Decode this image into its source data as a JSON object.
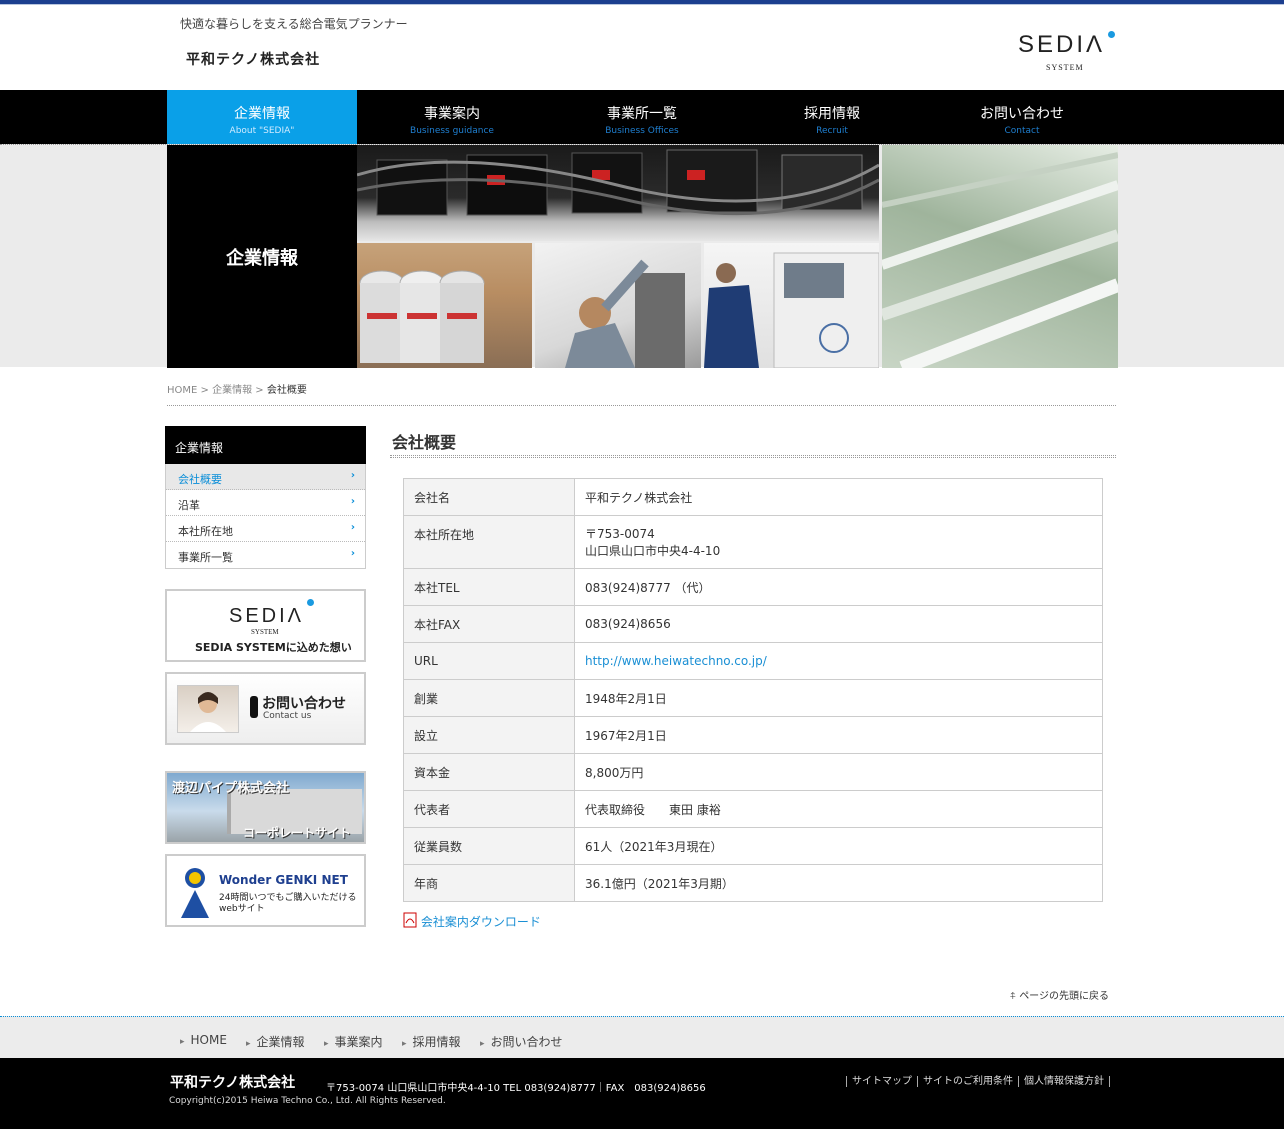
{
  "header": {
    "tagline": "快適な暮らしを支える総合電気プランナー",
    "company": "平和テクノ株式会社",
    "brand": "SEDIΛ",
    "brand_sub": "SYSTEM"
  },
  "nav": [
    {
      "jp": "企業情報",
      "en": "About \"SEDIA\""
    },
    {
      "jp": "事業案内",
      "en": "Business guidance"
    },
    {
      "jp": "事業所一覧",
      "en": "Business Offices"
    },
    {
      "jp": "採用情報",
      "en": "Recruit"
    },
    {
      "jp": "お問い合わせ",
      "en": "Contact"
    }
  ],
  "hero": {
    "title": "企業情報"
  },
  "breadcrumb": {
    "home": "HOME",
    "sep": ">",
    "parent": "企業情報",
    "current": "会社概要"
  },
  "sidebar": {
    "heading": "企業情報",
    "items": [
      "会社概要",
      "沿革",
      "本社所在地",
      "事業所一覧"
    ],
    "arrow": "›"
  },
  "banners": {
    "sedia_word": "SEDIΛ",
    "sedia_sub": "SYSTEM",
    "sedia_caption": "SEDIA SYSTEMに込めた想い",
    "contact_jp": "お問い合わせ",
    "contact_en": "Contact us",
    "watanabe_title": "渡辺パイプ株式会社",
    "watanabe_sub": "コーポレートサイト",
    "genki_title": "Wonder GENKI NET",
    "genki_line1": "24時間いつでもご購入いただける",
    "genki_line2": "webサイト"
  },
  "main": {
    "title": "会社概要",
    "rows": [
      {
        "k": "会社名",
        "v": "平和テクノ株式会社"
      },
      {
        "k": "本社所在地",
        "v": "〒753-0074",
        "v2": "山口県山口市中央4-4-10"
      },
      {
        "k": "本社TEL",
        "v": "083(924)8777 （代）"
      },
      {
        "k": "本社FAX",
        "v": "083(924)8656"
      },
      {
        "k": "URL",
        "v": "http://www.heiwatechno.co.jp/"
      },
      {
        "k": "創業",
        "v": "1948年2月1日"
      },
      {
        "k": "設立",
        "v": "1967年2月1日"
      },
      {
        "k": "資本金",
        "v": "8,800万円"
      },
      {
        "k": "代表者",
        "v": "代表取締役　　東田 康裕"
      },
      {
        "k": "従業員数",
        "v": "61人（2021年3月現在）"
      },
      {
        "k": "年商",
        "v": "36.1億円（2021年3月期）"
      }
    ],
    "download": "会社案内ダウンロード",
    "to_top": "ページの先頭に戻る"
  },
  "footer_nav": [
    "HOME",
    "企業情報",
    "事業案内",
    "採用情報",
    "お問い合わせ"
  ],
  "footer": {
    "company": "平和テクノ株式会社",
    "address": "〒753-0074 山口県山口市中央4-4-10 TEL 083(924)8777｜FAX　083(924)8656",
    "copyright": "Copyright(c)2015 Heiwa Techno Co., Ltd. All Rights Reserved.",
    "links": [
      "サイトマップ",
      "サイトのご利用条件",
      "個人情報保護方針"
    ]
  }
}
